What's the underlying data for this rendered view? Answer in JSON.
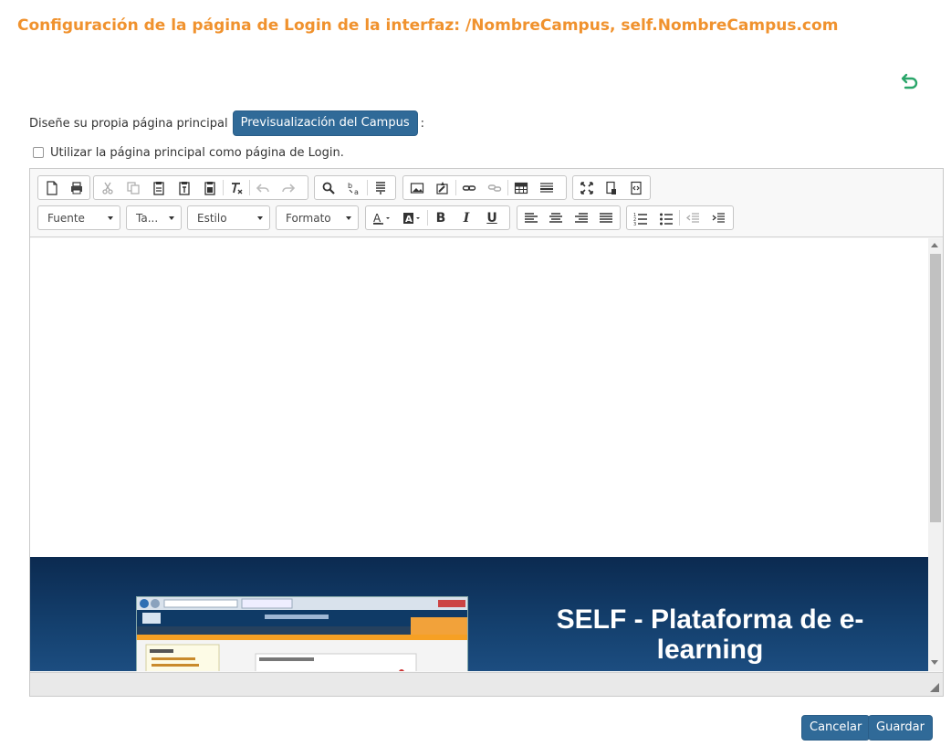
{
  "header": {
    "title": "Configuración de la página de Login de la interfaz: /NombreCampus, self.NombreCampus.com"
  },
  "design": {
    "label": "Diseñe su propia página principal",
    "preview_button": "Previsualización del Campus",
    "colon": ":"
  },
  "login_option": {
    "label": "Utilizar la página principal como página de Login.",
    "checked": false
  },
  "toolbar": {
    "row1_groups": [
      [
        "new-page-icon",
        "print-icon"
      ],
      [
        "cut-icon",
        "copy-icon",
        "paste-icon",
        "paste-text-icon",
        "paste-word-icon"
      ],
      [
        "remove-format-icon"
      ],
      [
        "undo-icon",
        "redo-icon"
      ],
      [
        "find-icon",
        "replace-icon",
        "select-all-icon"
      ],
      [
        "image-icon",
        "flash-icon",
        "link-icon",
        "unlink-icon",
        "table-icon",
        "horizontal-line-icon"
      ],
      [
        "maximize-icon",
        "show-blocks-icon",
        "source-icon"
      ]
    ],
    "font_label": "Fuente",
    "size_label": "Ta...",
    "style_label": "Estilo",
    "format_label": "Formato",
    "bold": "B",
    "italic": "I",
    "underline": "U"
  },
  "content": {
    "banner_title": "SELF - Plataforma de e-learning",
    "banner_color": "#0b2a50"
  },
  "footer": {
    "cancel": "Cancelar",
    "save": "Guardar"
  },
  "colors": {
    "title": "#f0922e",
    "button": "#306a98",
    "back_arrow": "#2aa66a"
  }
}
